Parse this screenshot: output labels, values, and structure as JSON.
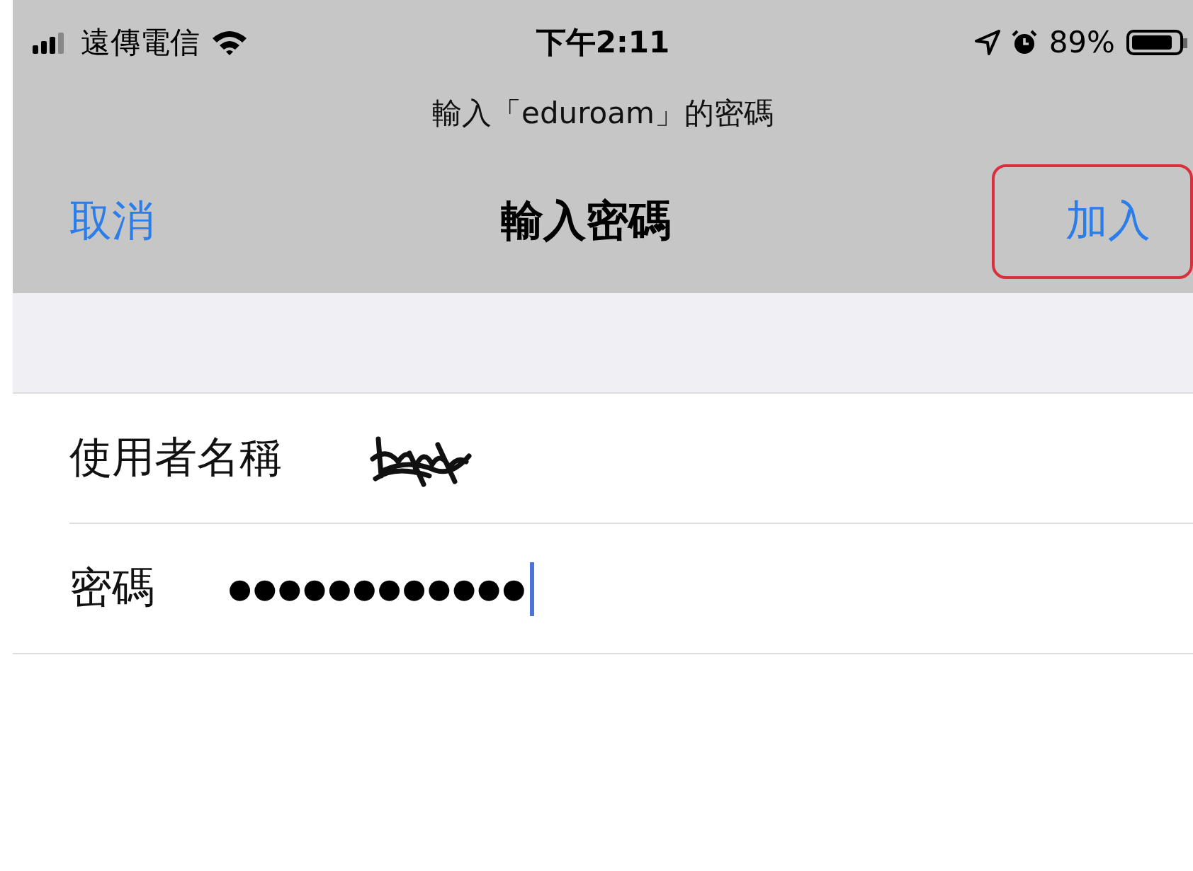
{
  "status_bar": {
    "carrier": "遠傳電信",
    "time": "下午2:11",
    "battery": "89%"
  },
  "prompt": "輸入「eduroam」的密碼",
  "nav": {
    "cancel": "取消",
    "title": "輸入密碼",
    "join": {
      "label": "加入",
      "highlighted": true
    }
  },
  "fields": [
    {
      "kind": "redacted",
      "label": "使用者名稱"
    },
    {
      "kind": "password",
      "label": "密碼",
      "value": "●●●●●●●●●●●●",
      "focused": true
    }
  ]
}
